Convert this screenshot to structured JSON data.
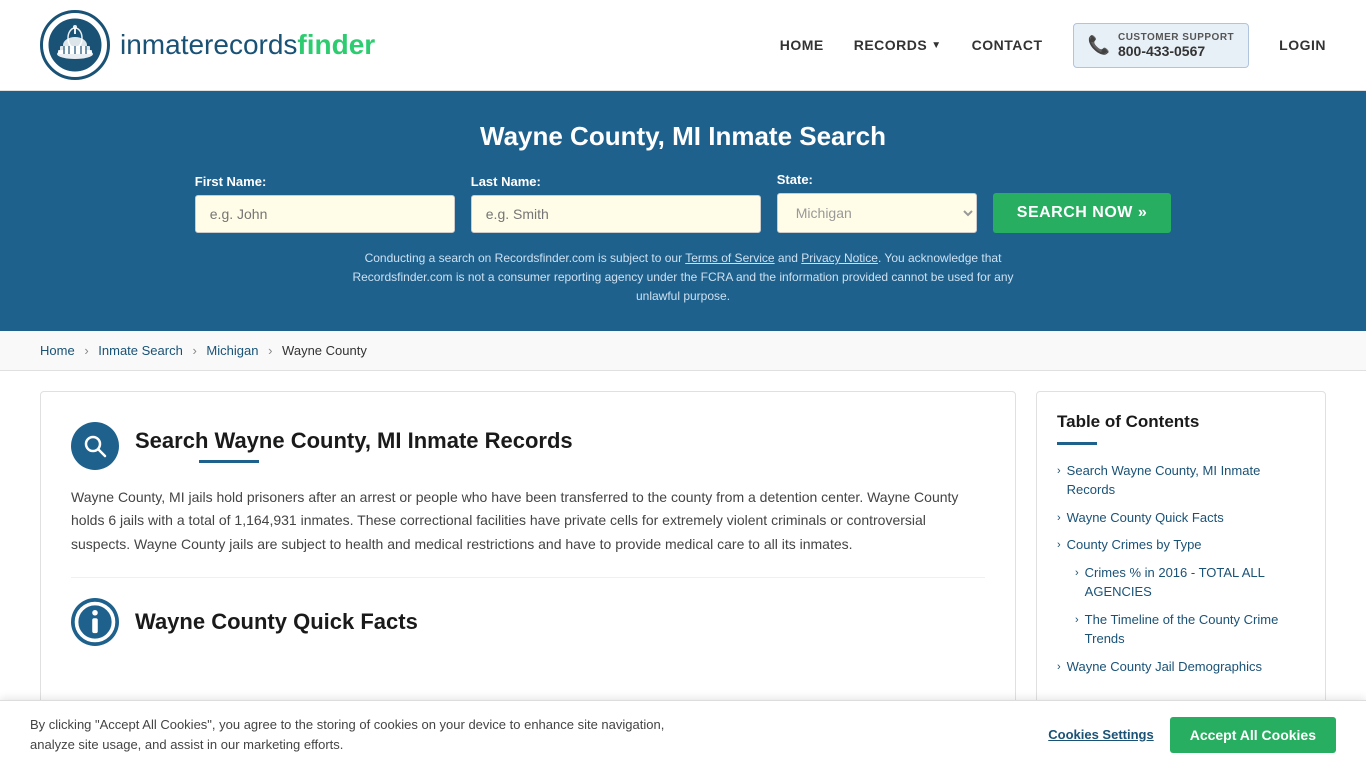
{
  "header": {
    "logo_text_main": "inmaterecords",
    "logo_text_finder": "finder",
    "nav": {
      "home": "HOME",
      "records": "RECORDS",
      "contact": "CONTACT",
      "support_label": "CUSTOMER SUPPORT",
      "support_number": "800-433-0567",
      "login": "LOGIN"
    }
  },
  "hero": {
    "title": "Wayne County, MI Inmate Search",
    "form": {
      "first_name_label": "First Name:",
      "first_name_placeholder": "e.g. John",
      "last_name_label": "Last Name:",
      "last_name_placeholder": "e.g. Smith",
      "state_label": "State:",
      "state_value": "Michigan",
      "search_button": "SEARCH NOW »"
    },
    "disclaimer": "Conducting a search on Recordsfinder.com is subject to our Terms of Service and Privacy Notice. You acknowledge that Recordsfinder.com is not a consumer reporting agency under the FCRA and the information provided cannot be used for any unlawful purpose."
  },
  "breadcrumb": {
    "home": "Home",
    "inmate_search": "Inmate Search",
    "michigan": "Michigan",
    "current": "Wayne County"
  },
  "main_section": {
    "title": "Search Wayne County, MI Inmate Records",
    "body": "Wayne County, MI jails hold prisoners after an arrest or people who have been transferred to the county from a detention center. Wayne County holds 6 jails with a total of 1,164,931 inmates. These correctional facilities have private cells for extremely violent criminals or controversial suspects. Wayne County jails are subject to health and medical restrictions and have to provide medical care to all its inmates."
  },
  "quick_facts": {
    "title": "Wayne County Quick Facts"
  },
  "toc": {
    "title": "Table of Contents",
    "items": [
      {
        "label": "Search Wayne County, MI Inmate Records",
        "sub": false
      },
      {
        "label": "Wayne County Quick Facts",
        "sub": false
      },
      {
        "label": "County Crimes by Type",
        "sub": false
      },
      {
        "label": "Crimes % in 2016 - TOTAL ALL AGENCIES",
        "sub": true
      },
      {
        "label": "The Timeline of the County Crime Trends",
        "sub": true
      },
      {
        "label": "Wayne County Jail Demographics",
        "sub": false
      }
    ]
  },
  "cookie": {
    "text": "By clicking \"Accept All Cookies\", you agree to the storing of cookies on your device to enhance site navigation, analyze site usage, and assist in our marketing efforts.",
    "settings_label": "Cookies Settings",
    "accept_label": "Accept All Cookies"
  }
}
